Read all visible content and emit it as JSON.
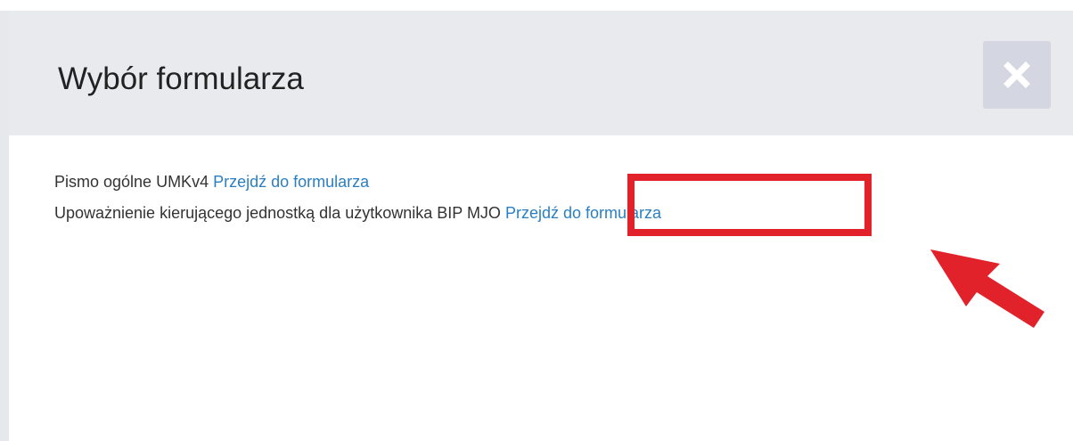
{
  "modal": {
    "title": "Wybór formularza",
    "close_icon": "close-icon",
    "forms": [
      {
        "name": "Pismo ogólne UMKv4",
        "link_label": "Przejdź do formularza"
      },
      {
        "name": "Upoważnienie kierującego jednostką dla użytkownika BIP MJO",
        "link_label": "Przejdź do formularza"
      }
    ]
  },
  "annotation": {
    "highlight_color": "#e2222b",
    "arrow_icon": "red-arrow-icon"
  },
  "colors": {
    "header_bg": "#e9eaed",
    "close_button_bg": "#d4d7e1",
    "link": "#2a7fc3",
    "text": "#333333"
  }
}
